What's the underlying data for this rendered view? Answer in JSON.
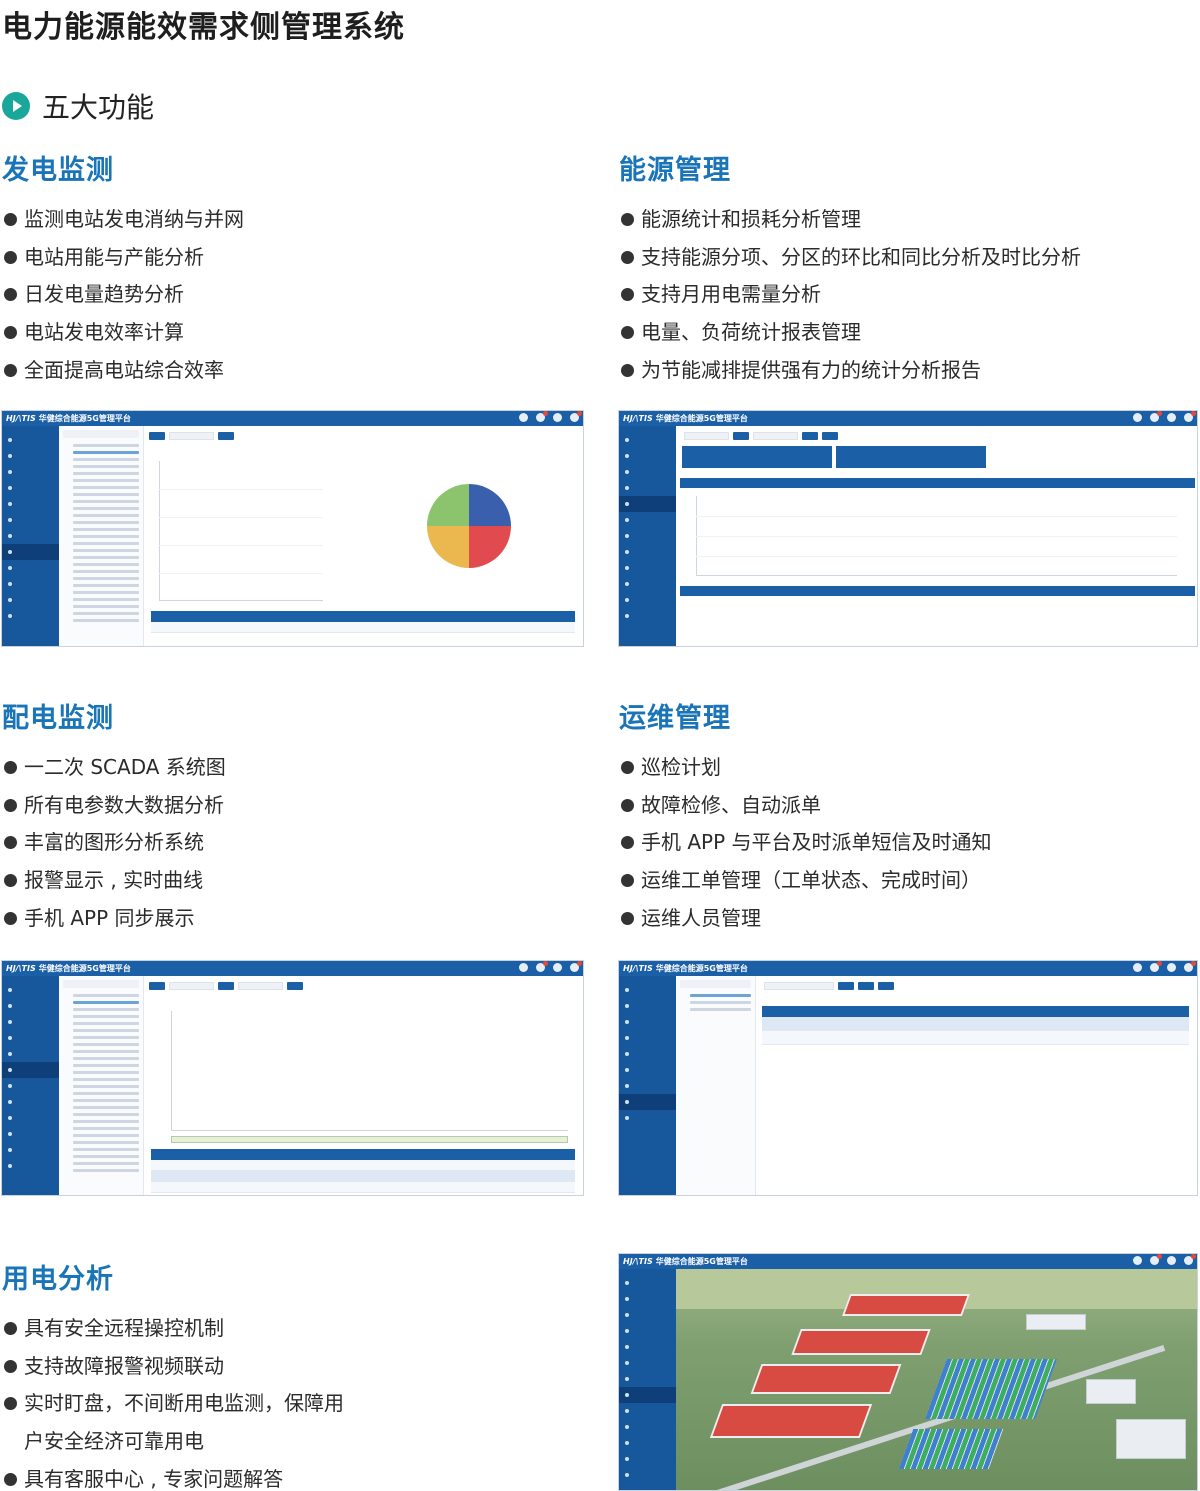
{
  "page": {
    "title": "电力能源能效需求侧管理系统",
    "section_title": "五大功能"
  },
  "features": [
    {
      "title": "发电监测",
      "items": [
        "监测电站发电消纳与并网",
        "电站用能与产能分析",
        "日发电量趋势分析",
        "电站发电效率计算",
        "全面提高电站综合效率"
      ]
    },
    {
      "title": "能源管理",
      "items": [
        "能源统计和损耗分析管理",
        "支持能源分项、分区的环比和同比分析及时比分析",
        "支持月用电需量分析",
        "电量、负荷统计报表管理",
        "为节能减排提供强有力的统计分析报告"
      ]
    },
    {
      "title": "配电监测",
      "items": [
        "一二次 SCADA 系统图",
        "所有电参数大数据分析",
        "丰富的图形分析系统",
        "报警显示 , 实时曲线",
        "手机 APP 同步展示"
      ]
    },
    {
      "title": "运维管理",
      "items": [
        "巡检计划",
        "故障检修、自动派单",
        "手机 APP 与平台及时派单短信及时通知",
        "运维工单管理（工单状态、完成时间）",
        "运维人员管理"
      ]
    },
    {
      "title": "用电分析",
      "items": [
        "具有安全远程操控机制",
        "支持故障报警视频联动",
        "实时盯盘，不间断用电监测，保障用",
        "户安全经济可靠用电",
        "具有客服中心 , 专家问题解答"
      ]
    }
  ],
  "app": {
    "logo": "HJ/\\TIS",
    "name": "华健综合能源5G管理平台"
  },
  "colors": {
    "accent_teal": "#1aa79b",
    "title_blue": "#1a74b8",
    "app_blue": "#1b5fa6"
  }
}
